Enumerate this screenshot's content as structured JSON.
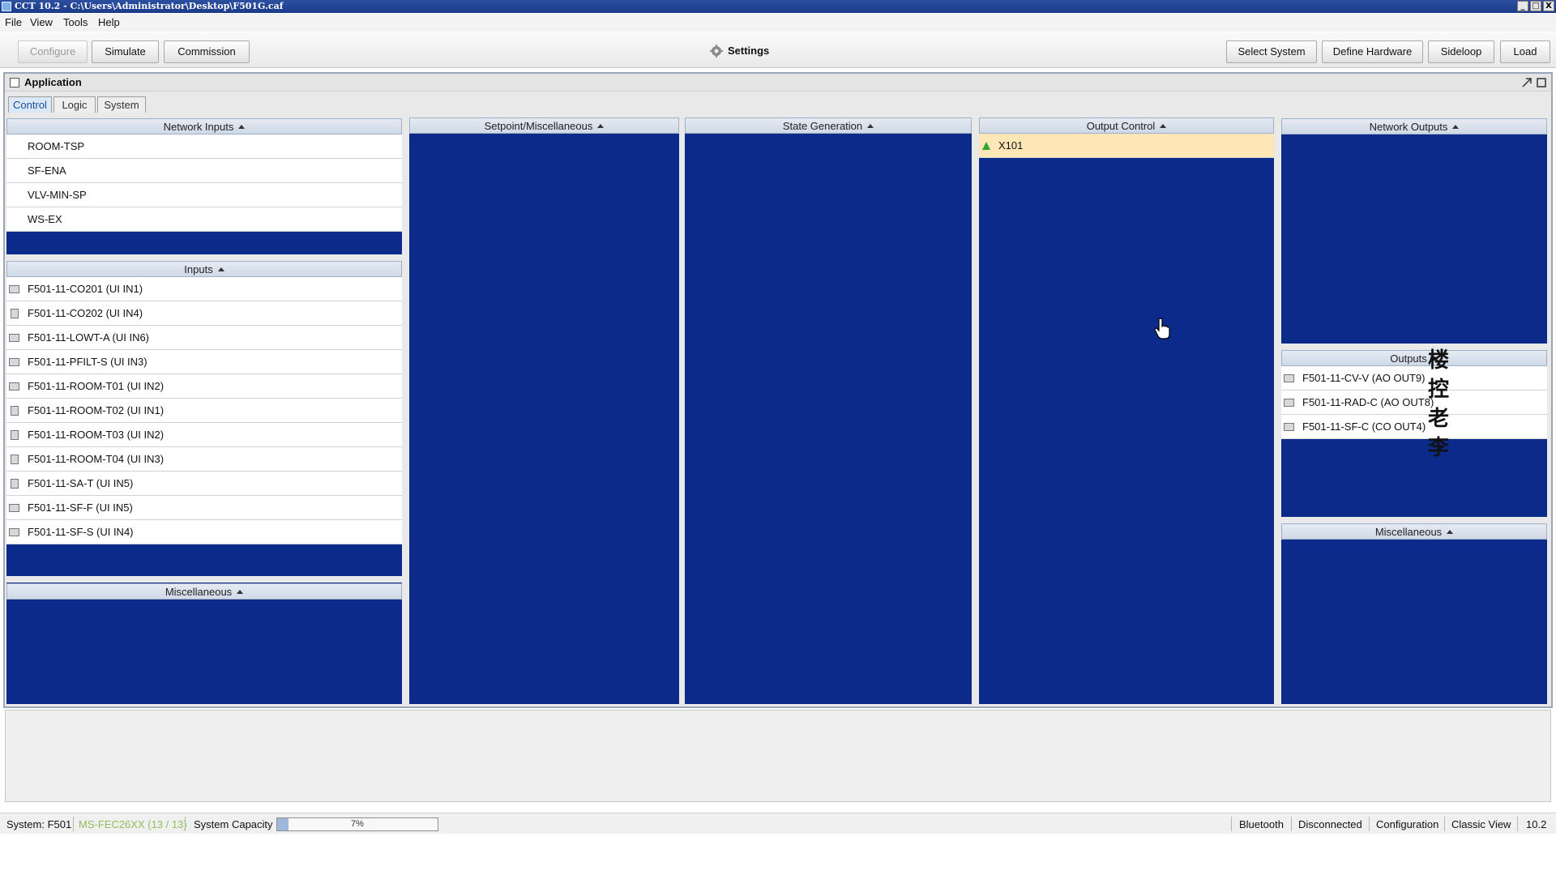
{
  "window": {
    "title": "CCT 10.2 - C:\\Users\\Administrator\\Desktop\\F501G.caf",
    "minimize": "_",
    "restore": "□",
    "close": "X"
  },
  "menu": [
    "File",
    "View",
    "Tools",
    "Help"
  ],
  "toolbar": {
    "left_buttons": [
      "Configure",
      "Simulate",
      "Commission"
    ],
    "settings_label": "Settings",
    "right_buttons": [
      "Select System",
      "Define Hardware",
      "Sideloop",
      "Load"
    ]
  },
  "application": {
    "title": "Application",
    "tabs": [
      "Control",
      "Logic",
      "System"
    ],
    "active_tab": "Control"
  },
  "panels": {
    "network_inputs": {
      "header": "Network Inputs",
      "items": [
        "ROOM-TSP",
        "SF-ENA",
        "VLV-MIN-SP",
        "WS-EX"
      ]
    },
    "inputs": {
      "header": "Inputs",
      "items": [
        {
          "label": "F501-11-CO201 (UI IN1)",
          "icon": "io-module-icon"
        },
        {
          "label": "F501-11-CO202 (UI IN4)",
          "icon": "sensor-icon"
        },
        {
          "label": "F501-11-LOWT-A (UI IN6)",
          "icon": "io-module-icon"
        },
        {
          "label": "F501-11-PFILT-S (UI IN3)",
          "icon": "io-module-icon"
        },
        {
          "label": "F501-11-ROOM-T01 (UI IN2)",
          "icon": "io-module-icon"
        },
        {
          "label": "F501-11-ROOM-T02 (UI IN1)",
          "icon": "sensor-icon"
        },
        {
          "label": "F501-11-ROOM-T03 (UI IN2)",
          "icon": "sensor-icon"
        },
        {
          "label": "F501-11-ROOM-T04 (UI IN3)",
          "icon": "sensor-icon"
        },
        {
          "label": "F501-11-SA-T (UI IN5)",
          "icon": "sensor-icon"
        },
        {
          "label": "F501-11-SF-F (UI IN5)",
          "icon": "io-module-icon"
        },
        {
          "label": "F501-11-SF-S (UI IN4)",
          "icon": "io-module-icon"
        }
      ]
    },
    "misc_left": {
      "header": "Miscellaneous"
    },
    "setpoint": {
      "header": "Setpoint/Miscellaneous"
    },
    "state_generation": {
      "header": "State Generation"
    },
    "output_control": {
      "header": "Output Control",
      "items": [
        "X101"
      ]
    },
    "network_outputs": {
      "header": "Network Outputs"
    },
    "outputs": {
      "header": "Outputs",
      "items": [
        {
          "label": "F501-11-CV-V (AO OUT9)",
          "icon": "io-module-icon"
        },
        {
          "label": "F501-11-RAD-C (AO OUT8)",
          "icon": "io-module-icon"
        },
        {
          "label": "F501-11-SF-C (CO OUT4)",
          "icon": "io-module-icon"
        }
      ]
    },
    "misc_right": {
      "header": "Miscellaneous"
    }
  },
  "watermark": [
    "楼",
    "控",
    "老",
    "李"
  ],
  "statusbar": {
    "system": "System: F501",
    "device": "MS-FEC26XX (13 / 13)",
    "capacity_label": "System Capacity",
    "capacity_value": "7%",
    "capacity_fraction": 0.07,
    "right_items": [
      "Bluetooth",
      "Disconnected",
      "Configuration",
      "Classic View",
      "10.2"
    ]
  },
  "colors": {
    "panel_blue": "#0b2a8a",
    "highlight_row": "#fde7b7",
    "device_text": "#8fbf5a",
    "title_bar": "#1b3b8a"
  }
}
